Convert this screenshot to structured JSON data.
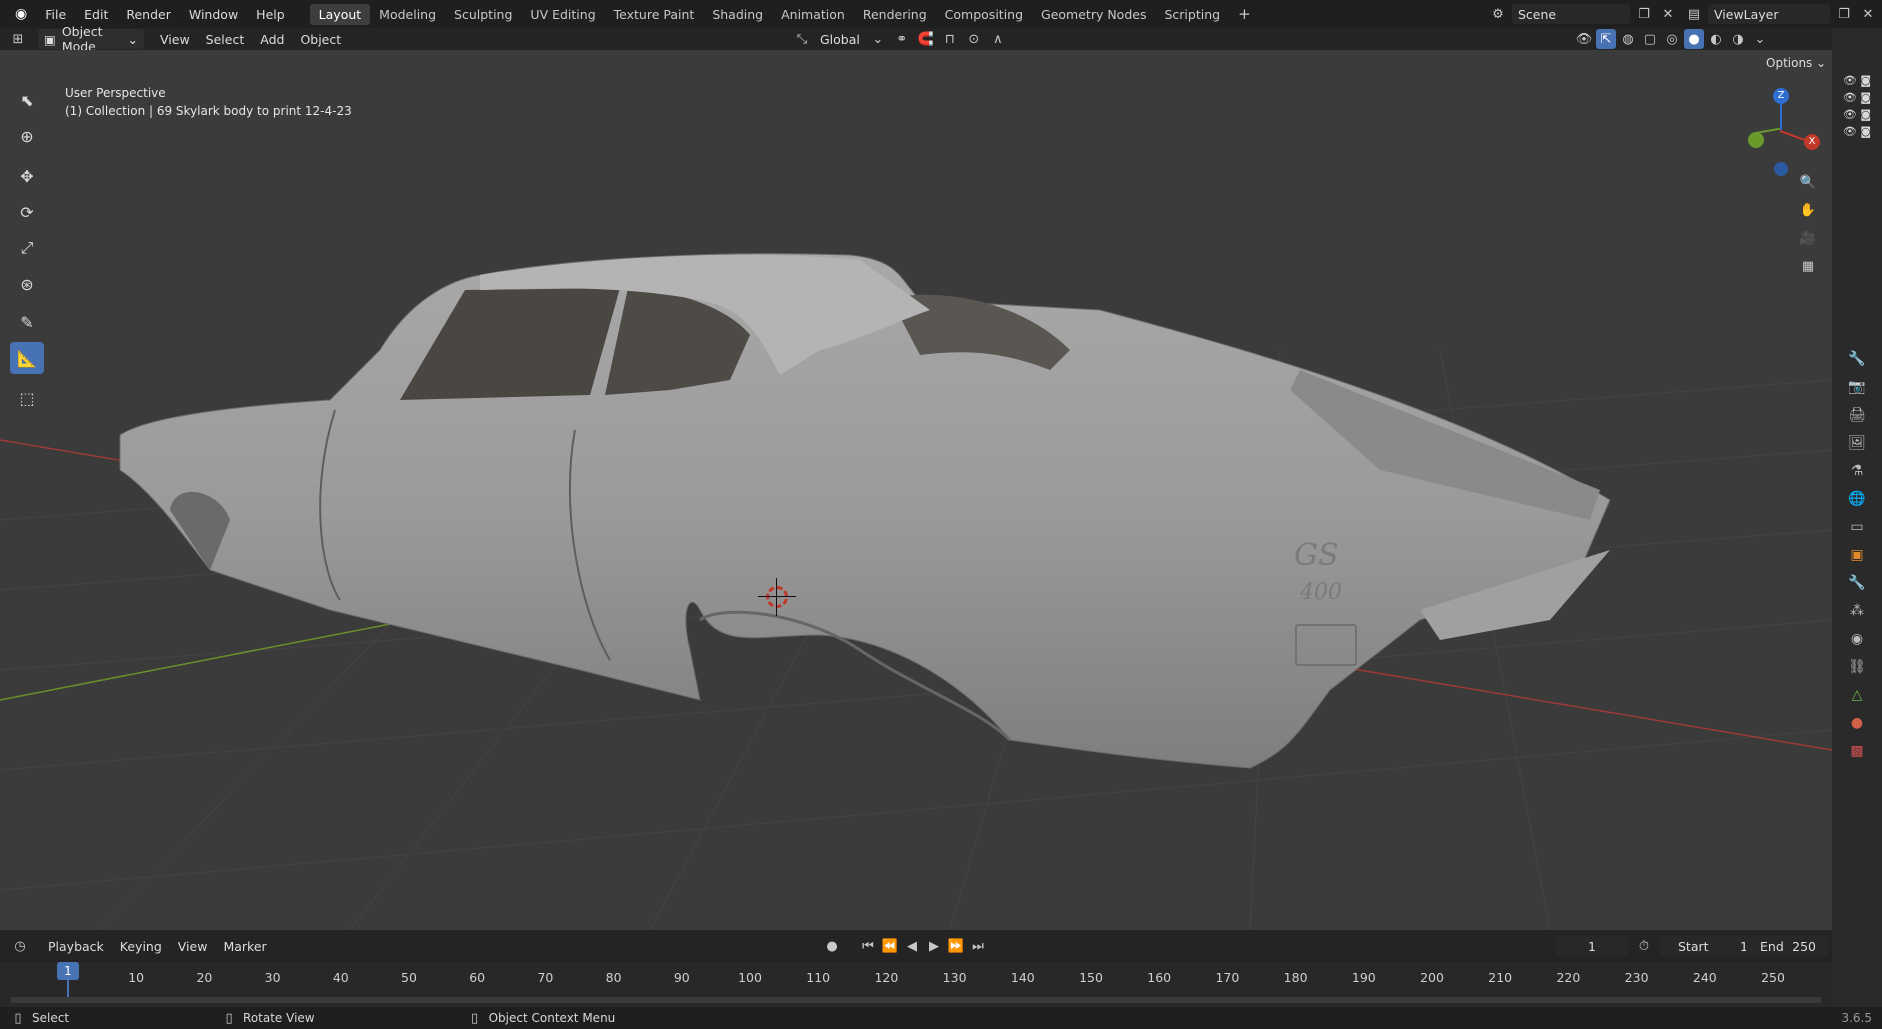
{
  "menu": {
    "file": "File",
    "edit": "Edit",
    "render": "Render",
    "window": "Window",
    "help": "Help"
  },
  "workspaces": [
    "Layout",
    "Modeling",
    "Sculpting",
    "UV Editing",
    "Texture Paint",
    "Shading",
    "Animation",
    "Rendering",
    "Compositing",
    "Geometry Nodes",
    "Scripting"
  ],
  "active_workspace": "Layout",
  "scene": {
    "name": "Scene"
  },
  "view_layer": {
    "name": "ViewLayer"
  },
  "header": {
    "mode": "Object Mode",
    "view": "View",
    "select": "Select",
    "add": "Add",
    "object": "Object",
    "orientation": "Global",
    "options": "Options"
  },
  "viewport": {
    "perspective": "User Perspective",
    "collection": "(1) Collection | 69 Skylark body to print 12-4-23",
    "emblem_line1": "GS",
    "emblem_line2": "400",
    "gizmo": {
      "z": "Z",
      "x": "X"
    }
  },
  "timeline": {
    "playback": "Playback",
    "keying": "Keying",
    "view": "View",
    "marker": "Marker",
    "current_frame": "1",
    "start_label": "Start",
    "start": "1",
    "end_label": "End",
    "end": "250",
    "ticks": [
      "10",
      "20",
      "30",
      "40",
      "50",
      "60",
      "70",
      "80",
      "90",
      "100",
      "110",
      "120",
      "130",
      "140",
      "150",
      "160",
      "170",
      "180",
      "190",
      "200",
      "210",
      "220",
      "230",
      "240",
      "250"
    ],
    "playhead": "1"
  },
  "status": {
    "select": "Select",
    "rotate": "Rotate View",
    "context": "Object Context Menu",
    "version": "3.6.5"
  },
  "colors": {
    "accent": "#4772b3",
    "x_axis": "#c0392b",
    "y_axis": "#6a9a2a",
    "z_axis": "#2c6fd0"
  }
}
